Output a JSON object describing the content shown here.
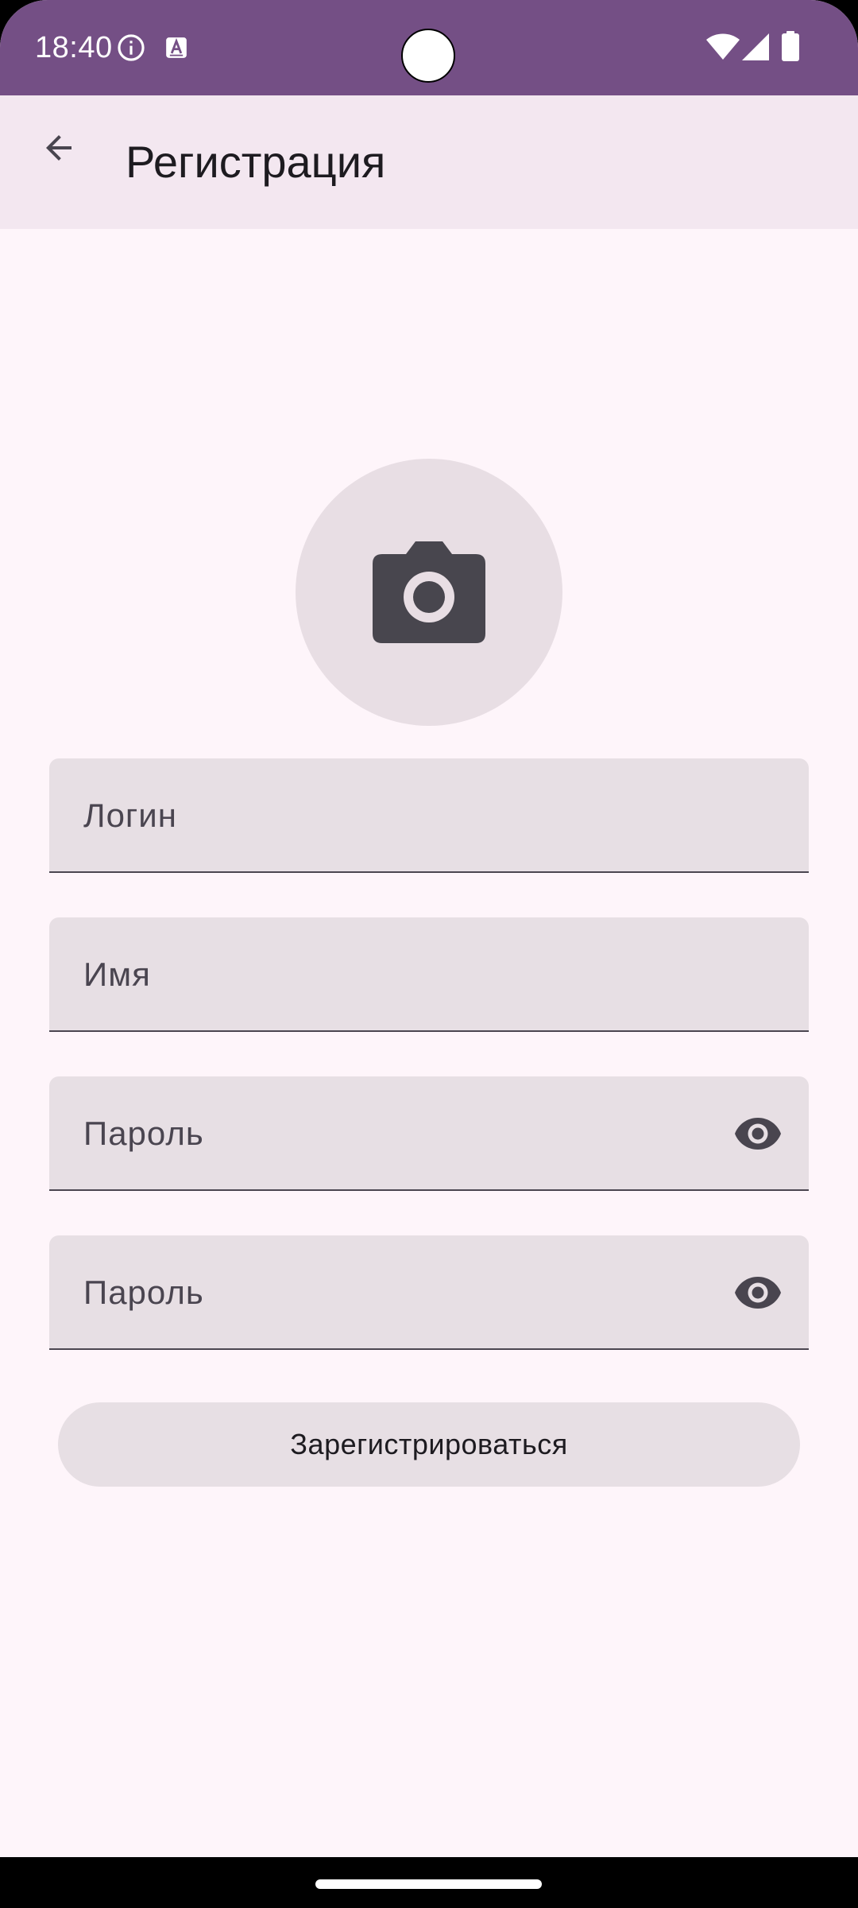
{
  "status_bar": {
    "time": "18:40",
    "icons": [
      "info-icon",
      "a-notification-icon",
      "wifi-icon",
      "signal-icon",
      "battery-icon"
    ]
  },
  "app_bar": {
    "back_icon": "arrow-back-icon",
    "title": "Регистрация"
  },
  "avatar": {
    "icon": "camera-icon"
  },
  "form": {
    "login_label": "Логин",
    "name_label": "Имя",
    "password_label": "Пароль",
    "password_confirm_label": "Пароль",
    "password_toggle_icon": "eye-icon"
  },
  "register_button": {
    "label": "Зарегистрироваться"
  },
  "colors": {
    "status_bar": "#744F85",
    "app_bar": "#F3E7F0",
    "background": "#FEF5FA",
    "field_fill": "#E7DFE4",
    "on_surface": "#1D1B20",
    "icon": "#49454F"
  }
}
